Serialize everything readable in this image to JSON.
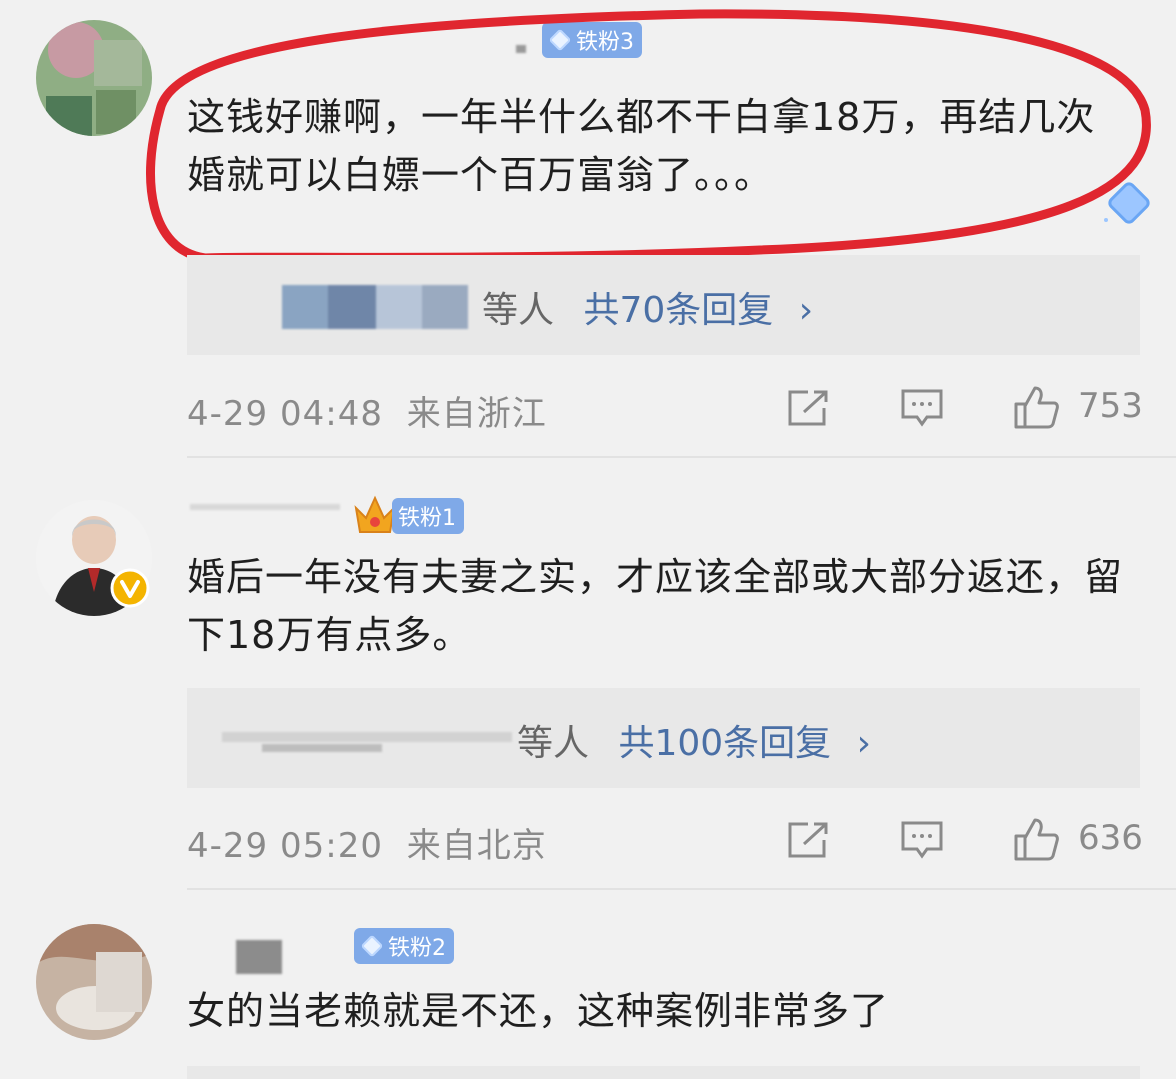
{
  "comments": [
    {
      "level": "铁粉3",
      "text": "这钱好赚啊，一年半什么都不干白拿18万，再结几次婚就可以白嫖一个百万富翁了。。。",
      "reply_suffix": "等人",
      "reply_count": "共70条回复",
      "date": "4-29 04:48",
      "location": "来自浙江",
      "likes": "753"
    },
    {
      "level": "铁粉1",
      "text": "婚后一年没有夫妻之实，才应该全部或大部分返还，留下18万有点多。",
      "reply_suffix": "等人",
      "reply_count": "共100条回复",
      "date": "4-29 05:20",
      "location": "来自北京",
      "likes": "636"
    },
    {
      "level": "铁粉2",
      "text": "女的当老赖就是不还，这种案例非常多了"
    }
  ],
  "reply_chevron": "›",
  "highlight_color": "#e0262f",
  "link_color": "#4a6fa5"
}
